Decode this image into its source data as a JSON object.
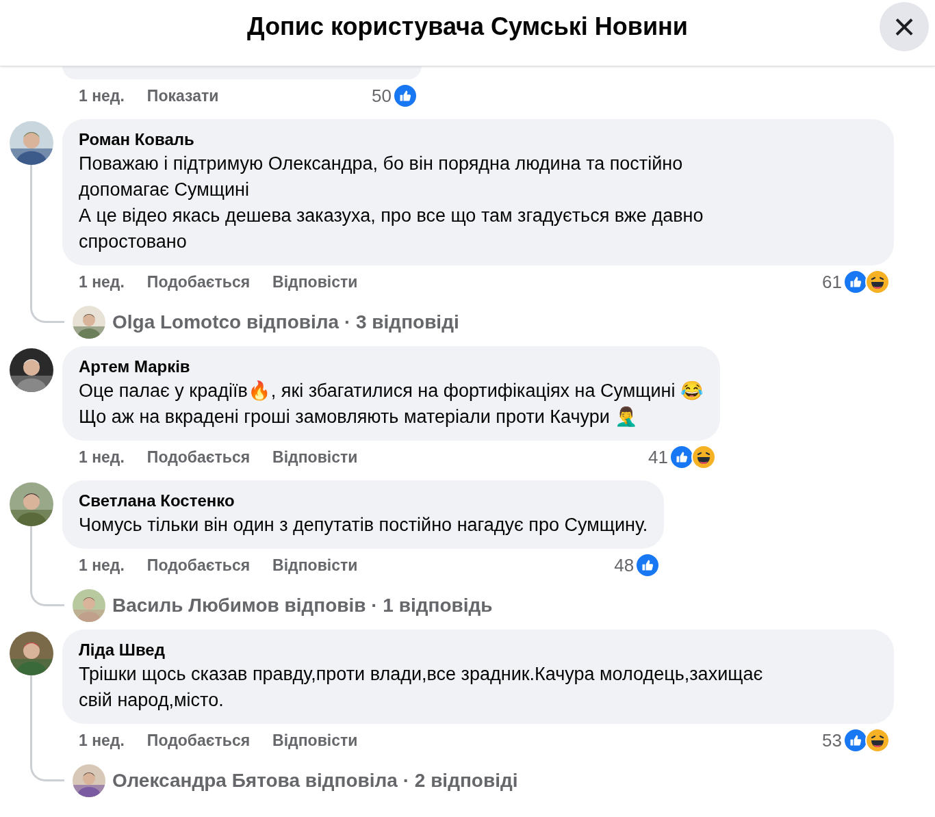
{
  "header": {
    "title": "Допис користувача Сумські Новини",
    "close": "×"
  },
  "partial_comment": {
    "time": "1 нед.",
    "actions": [
      "Показати"
    ],
    "reaction_count": "50",
    "reactions": [
      {
        "kind": "like"
      }
    ]
  },
  "comments": [
    {
      "author": "Роман Коваль",
      "text": "Поважаю і підтримую Олександра, бо він порядна людина та постійно\nдопомагає Сумщині\nА це відео якась дешева заказуха, про все що там згадується вже давно\nспростовано",
      "time": "1 нед.",
      "actions": [
        "Подобається",
        "Відповісти"
      ],
      "reaction_count": "61",
      "reactions": [
        {
          "kind": "like"
        },
        {
          "kind": "haha"
        }
      ],
      "reply": "Olga Lomotco відповіла · 3 відповіді"
    },
    {
      "author": "Артем Марків",
      "text": "Оце палає у крадіїв🔥, які збагатилися на фортифікаціях на Сумщині 😂\nЩо аж на вкрадені гроші замовляють матеріали проти Качури 🤦‍♂️",
      "time": "1 нед.",
      "actions": [
        "Подобається",
        "Відповісти"
      ],
      "reaction_count": "41",
      "reactions": [
        {
          "kind": "like"
        },
        {
          "kind": "haha"
        }
      ]
    },
    {
      "author": "Светлана Костенко",
      "text": "Чомусь тільки він один з депутатів постійно нагадує про Сумщину.",
      "time": "1 нед.",
      "actions": [
        "Подобається",
        "Відповісти"
      ],
      "reaction_count": "48",
      "reactions": [
        {
          "kind": "like"
        }
      ],
      "reply": "Василь Любимов відповів · 1 відповідь"
    },
    {
      "author": "Ліда Швед",
      "text": "Трішки щось сказав правду,проти влади,все зрадник.Качура молодець,захищає\nсвій народ,місто.",
      "time": "1 нед.",
      "actions": [
        "Подобається",
        "Відповісти"
      ],
      "reaction_count": "53",
      "reactions": [
        {
          "kind": "like"
        },
        {
          "kind": "haha"
        }
      ],
      "reply": "Олександра Бятова відповіла · 2 відповіді"
    }
  ]
}
